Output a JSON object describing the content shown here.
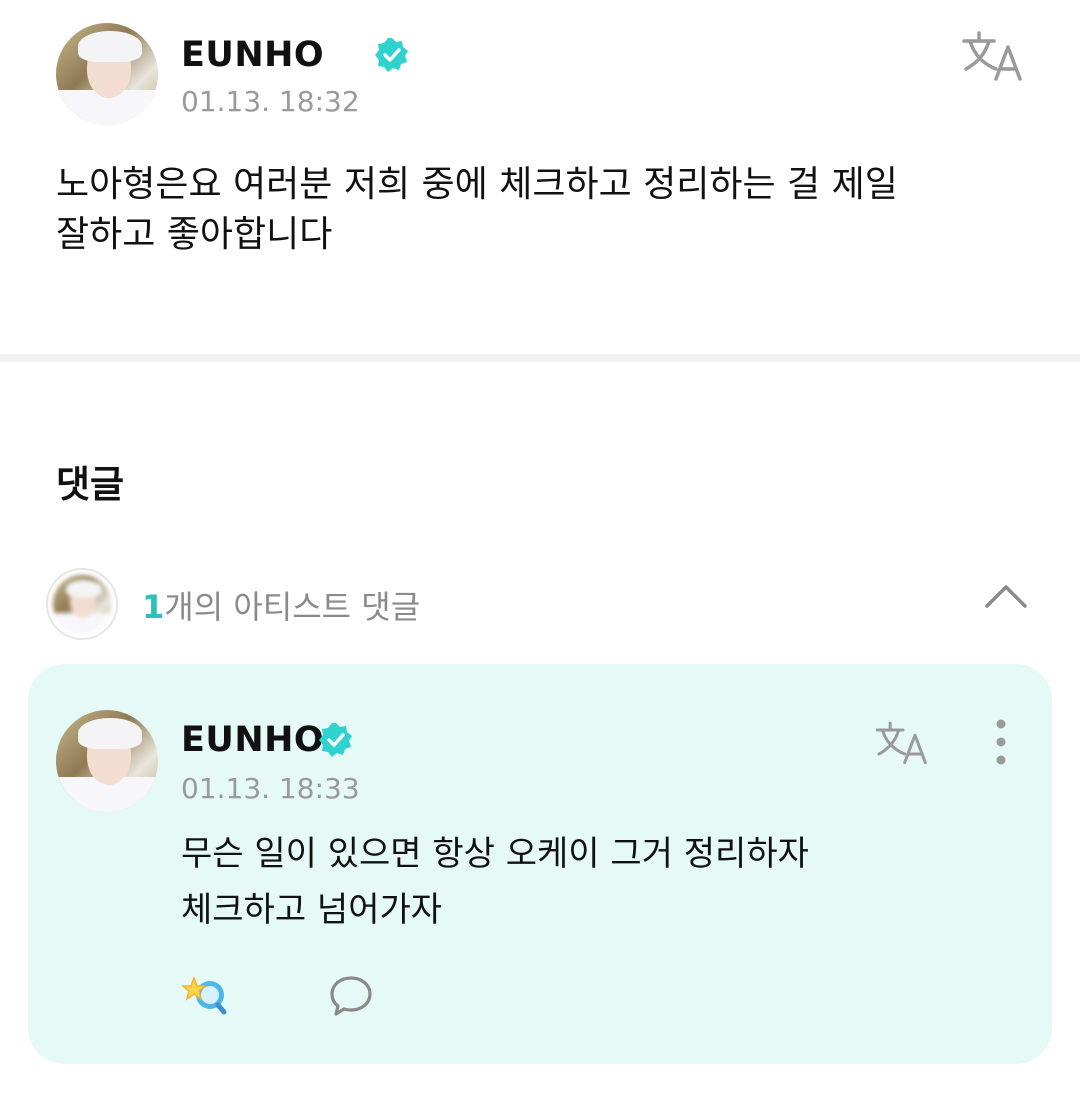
{
  "post": {
    "author": "EUNHO",
    "verified": true,
    "timestamp": "01.13. 18:32",
    "body": "노아형은요 여러분 저희 중에 체크하고 정리하는 걸 제일\n잘하고 좋아합니다",
    "translate_icon": "translate-icon"
  },
  "comments": {
    "title": "댓글",
    "artist_summary": {
      "count": "1",
      "label": "개의 아티스트 댓글",
      "toggle_icon": "chevron-up-icon"
    },
    "items": [
      {
        "author": "EUNHO",
        "verified": true,
        "timestamp": "01.13. 18:33",
        "body": "무슨 일이 있으면 항상 오케이 그거 정리하자\n체크하고 넘어가자",
        "icons": [
          "translate-icon",
          "more-vertical-icon",
          "reaction-icon",
          "reply-bubble-icon"
        ]
      }
    ]
  },
  "colors": {
    "accent": "#2cc0bb",
    "verified_badge": "#2ed3d0",
    "comment_card_bg": "#e5f9f6",
    "timestamp": "#9a9a9a"
  }
}
